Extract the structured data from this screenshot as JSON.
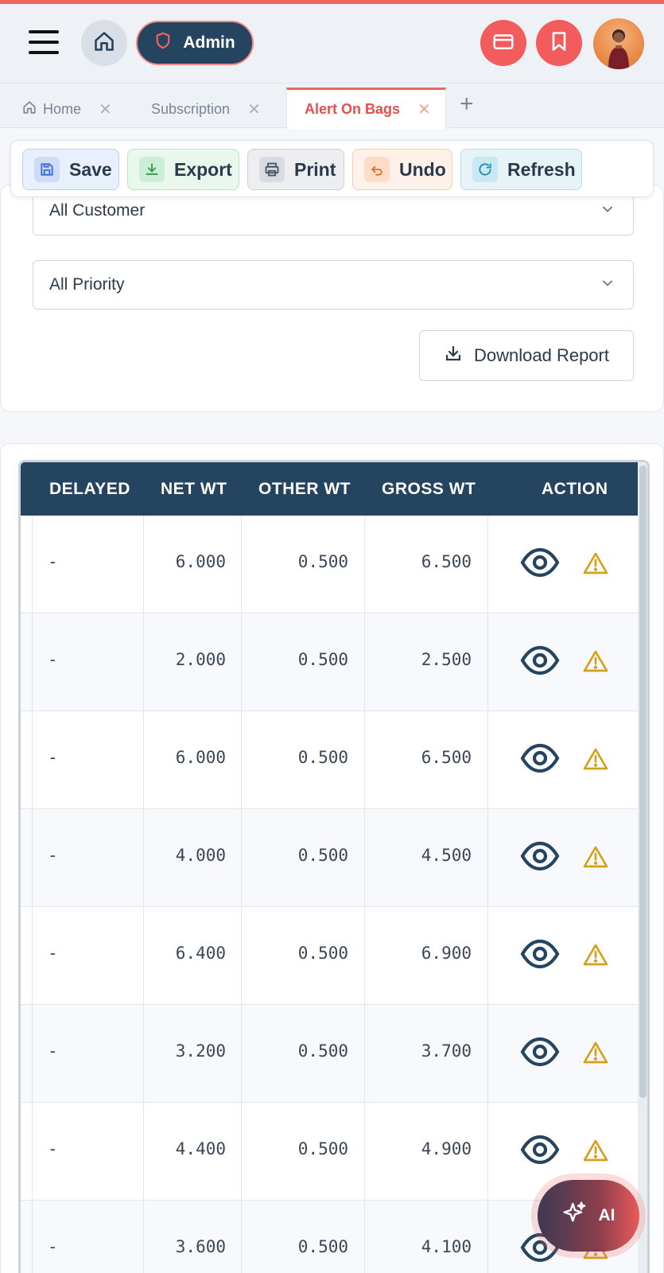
{
  "header": {
    "admin_label": "Admin"
  },
  "tabs": [
    {
      "label": "Home",
      "icon": "home-icon"
    },
    {
      "label": "Subscription"
    },
    {
      "label": "Alert On Bags",
      "active": true
    }
  ],
  "toolbar": {
    "save_label": "Save",
    "export_label": "Export",
    "print_label": "Print",
    "undo_label": "Undo",
    "refresh_label": "Refresh"
  },
  "filters": {
    "customer_value": "All Customer",
    "priority_value": "All Priority",
    "download_label": "Download Report"
  },
  "table": {
    "headers": [
      "DELAYED",
      "NET WT",
      "OTHER WT",
      "GROSS WT",
      "ACTION"
    ],
    "rows": [
      {
        "delayed": "-",
        "net": "6.000",
        "other": "0.500",
        "gross": "6.500"
      },
      {
        "delayed": "-",
        "net": "2.000",
        "other": "0.500",
        "gross": "2.500"
      },
      {
        "delayed": "-",
        "net": "6.000",
        "other": "0.500",
        "gross": "6.500"
      },
      {
        "delayed": "-",
        "net": "4.000",
        "other": "0.500",
        "gross": "4.500"
      },
      {
        "delayed": "-",
        "net": "6.400",
        "other": "0.500",
        "gross": "6.900"
      },
      {
        "delayed": "-",
        "net": "3.200",
        "other": "0.500",
        "gross": "3.700"
      },
      {
        "delayed": "-",
        "net": "4.400",
        "other": "0.500",
        "gross": "4.900"
      },
      {
        "delayed": "-",
        "net": "3.600",
        "other": "0.500",
        "gross": "4.100"
      }
    ]
  },
  "ai_button": {
    "label": "AI"
  },
  "colors": {
    "accent": "#f0645f",
    "header_navy": "#24445f",
    "warning": "#d4a017"
  }
}
